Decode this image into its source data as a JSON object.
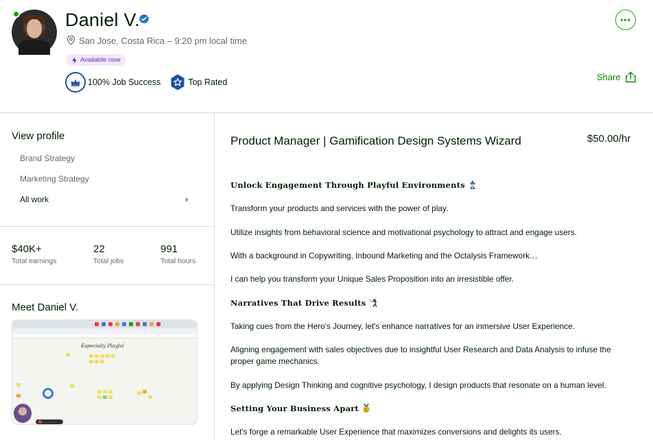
{
  "profile": {
    "name": "Daniel V.",
    "location": "San Jose, Costa Rica – 9:20 pm local time",
    "availability": "Available now",
    "job_success": "100% Job Success",
    "top_rated": "Top Rated",
    "share_label": "Share",
    "more_label": "•••"
  },
  "sidebar": {
    "view_profile_title": "View profile",
    "items": [
      {
        "label": "Brand Strategy"
      },
      {
        "label": "Marketing Strategy"
      },
      {
        "label": "All work"
      }
    ],
    "chevron": "›",
    "stats": [
      {
        "value": "$40K+",
        "label": "Total earnings"
      },
      {
        "value": "22",
        "label": "Total jobs"
      },
      {
        "value": "991",
        "label": "Total hours"
      }
    ],
    "meet_title": "Meet Daniel V.",
    "video_board_title": "Especially Playful"
  },
  "main": {
    "title": "Product Manager | Gamification Design Systems Wizard",
    "rate": "$50.00/hr",
    "sections": [
      {
        "heading": "Unlock Engagement Through Playful Environments",
        "heading_icon": "mage-emoji-icon",
        "paragraphs": [
          "Transform your products and services with the power of play.",
          "Utilize insights from behavioral science and motivational psychology to attract and engage users.",
          "With a background in Copywriting, Inbound Marketing and the Octalysis Framework…",
          "I can help you transform your Unique Sales Proposition into an irresistible offer."
        ]
      },
      {
        "heading": "Narratives That Drive Results",
        "heading_icon": "fencer-emoji-icon",
        "paragraphs": [
          "Taking cues from the Hero's Journey, let's enhance narratives for an inmersive User Experience.",
          "Aligning engagement with sales objectives due to insightful User Research and Data Analysis to infuse the proper game mechanics.",
          "By applying Design Thinking and cognitive psychology, I design products that resonate on a human level."
        ]
      },
      {
        "heading": "Setting Your Business Apart",
        "heading_icon": "medal-emoji-icon",
        "paragraphs": [
          "Let's forge a remarkable User Experience that maximizes conversions and delights its users."
        ]
      }
    ]
  },
  "colors": {
    "brand_green": "#14a800",
    "link_green": "#108a00",
    "availability_bg": "#f1eafd",
    "availability_text": "#5f2db7",
    "badge_blue": "#1e4fa8",
    "divider": "#d5e0d5",
    "muted_text": "#5e6d55"
  }
}
